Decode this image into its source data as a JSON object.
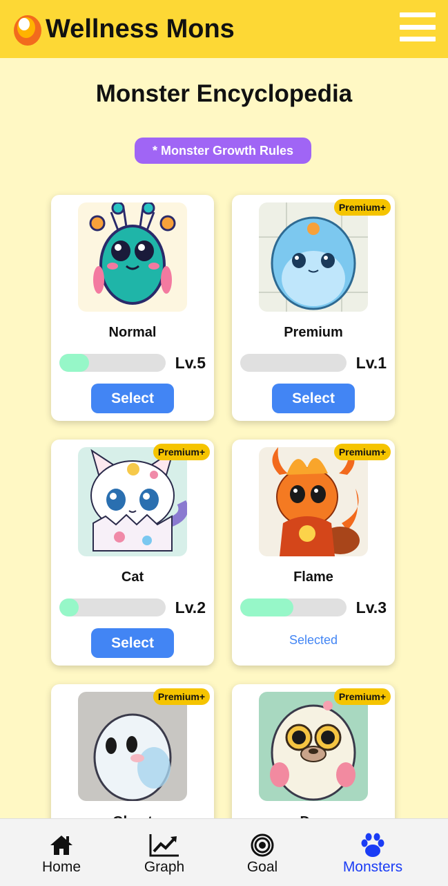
{
  "header": {
    "title": "Wellness Mons"
  },
  "page": {
    "title": "Monster Encyclopedia",
    "rules_button": "* Monster Growth Rules"
  },
  "monsters": [
    {
      "name": "Normal",
      "level": "Lv.5",
      "progress": 0.28,
      "badge": "",
      "action": "Select"
    },
    {
      "name": "Premium",
      "level": "Lv.1",
      "progress": 0.0,
      "badge": "Premium+",
      "action": "Select"
    },
    {
      "name": "Cat",
      "level": "Lv.2",
      "progress": 0.18,
      "badge": "Premium+",
      "action": "Select"
    },
    {
      "name": "Flame",
      "level": "Lv.3",
      "progress": 0.5,
      "badge": "Premium+",
      "status": "Selected"
    },
    {
      "name": "Ghost",
      "badge": "Premium+"
    },
    {
      "name": "Dog",
      "badge": "Premium+"
    }
  ],
  "nav": [
    {
      "label": "Home",
      "icon": "home-icon"
    },
    {
      "label": "Graph",
      "icon": "chart-icon"
    },
    {
      "label": "Goal",
      "icon": "target-icon"
    },
    {
      "label": "Monsters",
      "icon": "paw-icon",
      "active": true
    }
  ],
  "colors": {
    "header": "#fdd835",
    "background": "#fff8c4",
    "accent": "#4285f4",
    "rules": "#a065f5",
    "badge": "#f5c400",
    "progress": "#96f7c8",
    "active_nav": "#1a3cf5"
  }
}
